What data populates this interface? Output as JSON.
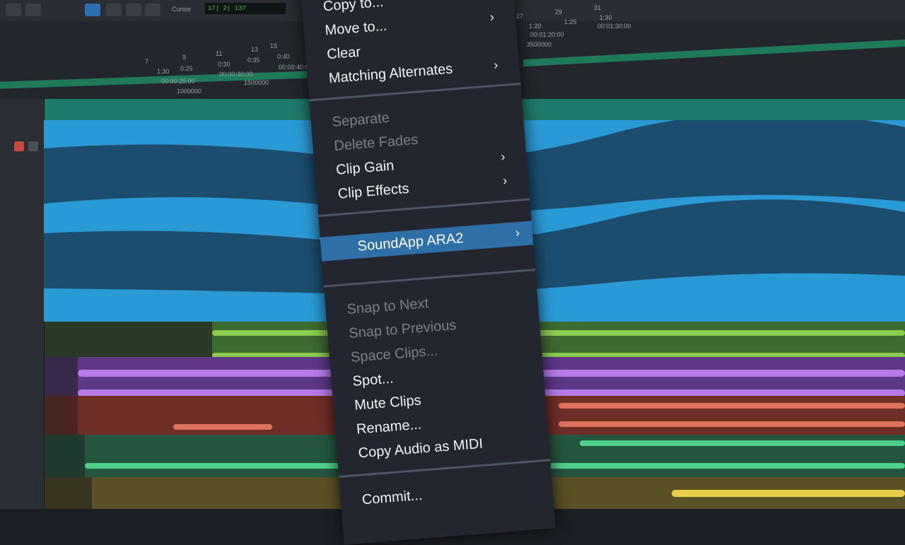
{
  "toolbar": {
    "cursor_label": "Cursor",
    "counter": "17| 2| 137"
  },
  "ruler": {
    "bar_numbers_top": [
      "27",
      "29",
      "31"
    ],
    "time_top": [
      "1:20",
      "1:25",
      "1:30"
    ],
    "timecode_top": [
      "00:01:20:00",
      "00:01:30:00"
    ],
    "sample_top": "3500000",
    "bar_numbers_left": [
      "7",
      "9",
      "11",
      "13",
      "15"
    ],
    "time_left": [
      "1:30",
      "0:25",
      "0:30",
      "0:35",
      "0:40"
    ],
    "timecode_left": [
      "00:00:25:00",
      "00:00:30:00",
      "00:00:40:0"
    ],
    "sample_left": [
      "1000000",
      "1500000"
    ]
  },
  "menu": {
    "items_top": [
      {
        "label": "Copy to...",
        "submenu": true,
        "disabled": false
      },
      {
        "label": "Move to...",
        "submenu": true,
        "disabled": false
      },
      {
        "label": "Clear",
        "submenu": false,
        "disabled": false
      },
      {
        "label": "Matching Alternates",
        "submenu": true,
        "disabled": false
      }
    ],
    "items_clip": [
      {
        "label": "Separate",
        "submenu": false,
        "disabled": true
      },
      {
        "label": "Delete Fades",
        "submenu": false,
        "disabled": true
      },
      {
        "label": "Clip Gain",
        "submenu": true,
        "disabled": false
      },
      {
        "label": "Clip Effects",
        "submenu": true,
        "disabled": false
      }
    ],
    "highlighted": {
      "label": "SoundApp ARA2",
      "submenu": true
    },
    "items_snap": [
      {
        "label": "Snap to Next",
        "disabled": true
      },
      {
        "label": "Snap to Previous",
        "disabled": true
      },
      {
        "label": "Space Clips...",
        "disabled": true
      },
      {
        "label": "Spot...",
        "disabled": false
      },
      {
        "label": "Mute Clips",
        "disabled": false
      },
      {
        "label": "Rename...",
        "disabled": false
      },
      {
        "label": "Copy Audio as MIDI",
        "disabled": false
      }
    ],
    "items_bottom": [
      {
        "label": "Commit...",
        "disabled": false
      }
    ],
    "chevron_glyph": "›"
  },
  "colors": {
    "menu_bg": "#23262f",
    "highlight": "#2f6fa8",
    "blue_clip": "#2a9ad6",
    "green_clip": "#4f9a3a",
    "purple_clip": "#8a4fc8",
    "red_clip": "#c9503e",
    "teal_clip": "#2fa36e",
    "yellow_clip": "#c9b23a"
  }
}
